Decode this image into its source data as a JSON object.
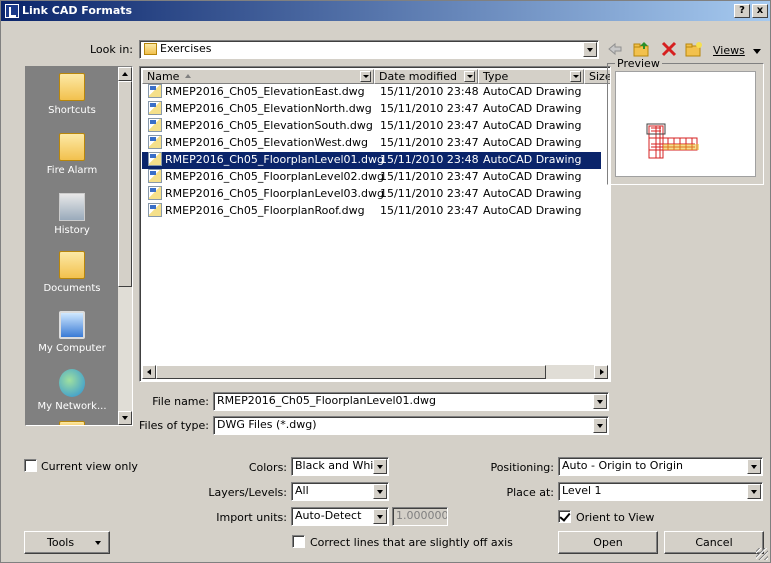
{
  "window": {
    "title": "Link CAD Formats",
    "help_glyph": "?",
    "close_glyph": "x"
  },
  "toolbar": {
    "look_in_label": "Look in:",
    "look_in_value": "Exercises",
    "views_label": "Views"
  },
  "places": [
    {
      "label": "Shortcuts",
      "icon": "folder-icon"
    },
    {
      "label": "Fire Alarm",
      "icon": "folder-icon"
    },
    {
      "label": "History",
      "icon": "history-icon"
    },
    {
      "label": "Documents",
      "icon": "folder-icon"
    },
    {
      "label": "My Computer",
      "icon": "computer-icon"
    },
    {
      "label": "My Network...",
      "icon": "network-icon"
    }
  ],
  "filelist": {
    "columns": {
      "name": "Name",
      "modified": "Date modified",
      "type": "Type",
      "size": "Size"
    },
    "rows": [
      {
        "name": "RMEP2016_Ch05_ElevationEast.dwg",
        "modified": "15/11/2010 23:48",
        "type": "AutoCAD Drawing"
      },
      {
        "name": "RMEP2016_Ch05_ElevationNorth.dwg",
        "modified": "15/11/2010 23:47",
        "type": "AutoCAD Drawing"
      },
      {
        "name": "RMEP2016_Ch05_ElevationSouth.dwg",
        "modified": "15/11/2010 23:47",
        "type": "AutoCAD Drawing"
      },
      {
        "name": "RMEP2016_Ch05_ElevationWest.dwg",
        "modified": "15/11/2010 23:47",
        "type": "AutoCAD Drawing"
      },
      {
        "name": "RMEP2016_Ch05_FloorplanLevel01.dwg",
        "modified": "15/11/2010 23:48",
        "type": "AutoCAD Drawing"
      },
      {
        "name": "RMEP2016_Ch05_FloorplanLevel02.dwg",
        "modified": "15/11/2010 23:47",
        "type": "AutoCAD Drawing"
      },
      {
        "name": "RMEP2016_Ch05_FloorplanLevel03.dwg",
        "modified": "15/11/2010 23:47",
        "type": "AutoCAD Drawing"
      },
      {
        "name": "RMEP2016_Ch05_FloorplanRoof.dwg",
        "modified": "15/11/2010 23:47",
        "type": "AutoCAD Drawing"
      }
    ]
  },
  "preview": {
    "label": "Preview"
  },
  "file_name": {
    "label": "File name:",
    "value": "RMEP2016_Ch05_FloorplanLevel01.dwg"
  },
  "file_type": {
    "label": "Files of type:",
    "value": "DWG Files  (*.dwg)"
  },
  "options": {
    "current_view_only": "Current view only",
    "colors_label": "Colors:",
    "colors_value": "Black and White",
    "layers_label": "Layers/Levels:",
    "layers_value": "All",
    "units_label": "Import units:",
    "units_value": "Auto-Detect",
    "units_factor": "1.000000",
    "correct_lines": "Correct lines that are slightly off axis",
    "positioning_label": "Positioning:",
    "positioning_value": "Auto - Origin to Origin",
    "place_at_label": "Place at:",
    "place_at_value": "Level 1",
    "orient_to_view": "Orient to View"
  },
  "buttons": {
    "tools": "Tools",
    "open": "Open",
    "cancel": "Cancel"
  },
  "colors": {
    "selection": "#0a246a",
    "title_start": "#0a246a",
    "title_end": "#a6caf0",
    "dialog_bg": "#d4d0c8",
    "places_bg": "#808080"
  }
}
